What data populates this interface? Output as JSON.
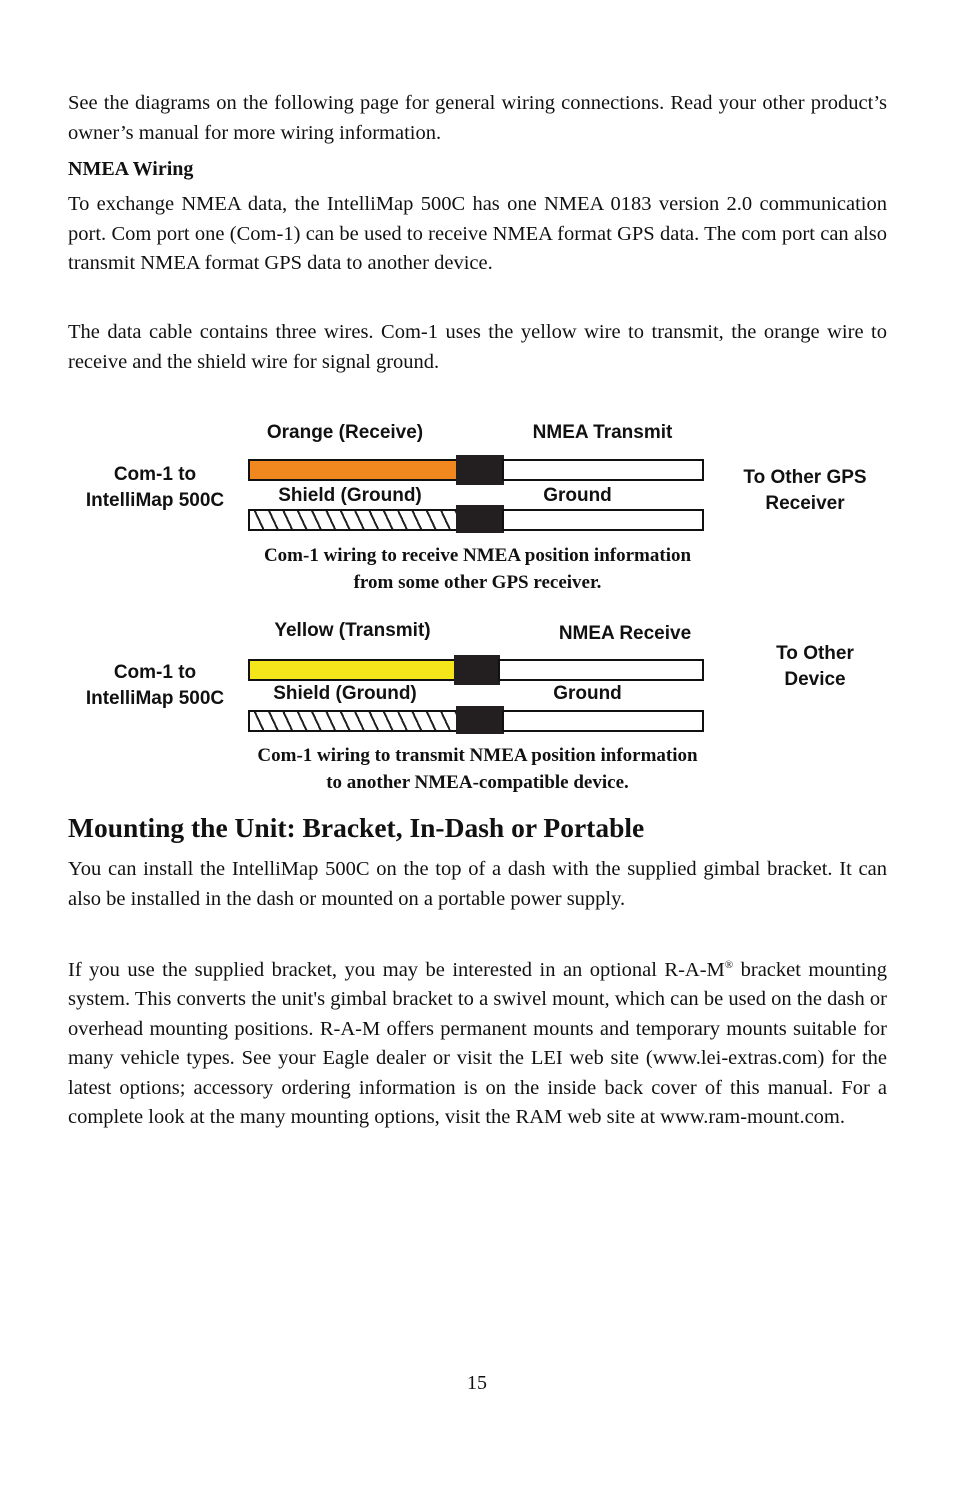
{
  "intro": "See the diagrams on the following page for general wiring connections. Read your other product’s owner’s manual for more wiring information.",
  "nmea_heading": "NMEA Wiring",
  "nmea_p1": "To exchange NMEA data, the IntelliMap 500C has one NMEA 0183 version 2.0 communication port. Com port one (Com-1) can be used to receive NMEA format GPS data. The com port can also transmit NMEA format GPS data to another device.",
  "nmea_p2": "The data cable contains three wires. Com-1 uses the yellow wire to transmit, the orange wire to receive and the shield wire for signal ground.",
  "diagram1": {
    "left_label": "Com-1 to IntelliMap 500C",
    "wire1_label": "Orange (Receive)",
    "wire1_far_label": "NMEA Transmit",
    "wire2_label": "Shield (Ground)",
    "wire2_far_label": "Ground",
    "right_label": "To Other GPS Receiver",
    "wire1_color": "#f0871f",
    "caption_line1": "Com-1 wiring to receive NMEA position information",
    "caption_line2": "from some other GPS receiver."
  },
  "diagram2": {
    "left_label": "Com-1 to IntelliMap 500C",
    "wire1_label": "Yellow (Transmit)",
    "wire1_far_label": "NMEA Receive",
    "wire2_label": "Shield (Ground)",
    "wire2_far_label": "Ground",
    "right_label": "To Other Device",
    "wire1_color": "#f5e61c",
    "caption_line1": "Com-1 wiring to transmit NMEA position information",
    "caption_line2": "to another NMEA-compatible device."
  },
  "mount_heading": "Mounting the Unit: Bracket, In-Dash or Portable",
  "mount_p1": "You can install the IntelliMap 500C on the top of a dash with the sup­plied gimbal bracket. It can also be installed in the dash or mounted on a portable power supply.",
  "mount_p2_a": "If you use the supplied bracket, you may be interested in an optional R-A-M",
  "mount_p2_sup": "®",
  "mount_p2_b": " bracket mounting system. This converts the unit's gimbal bracket to a swivel mount, which can be used on the dash or overhead mounting positions. R-A-M offers permanent mounts and temporary mounts suitable for many vehicle types. See your Eagle dealer or visit the LEI web site (www.lei-extras.com) for the latest options; accessory ordering information is on the inside back cover of this manual. For a complete look at the many mounting options, visit the RAM web site at www.ram-mount.com.",
  "page_number": "15"
}
